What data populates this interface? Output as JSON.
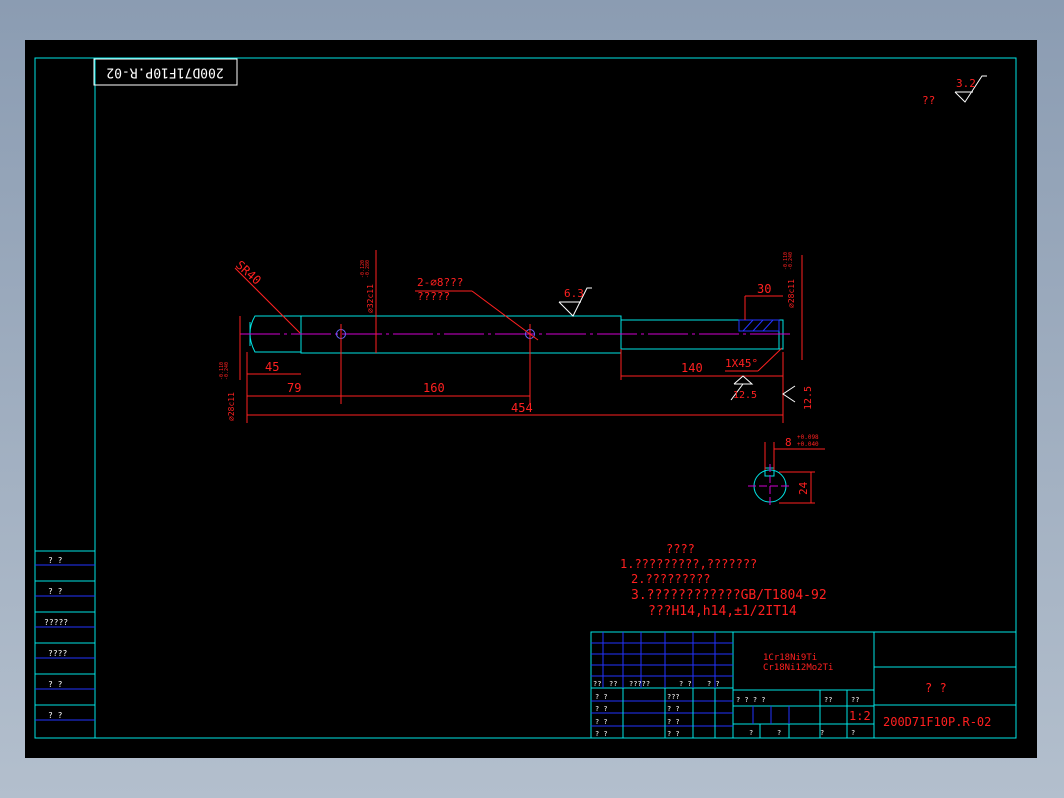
{
  "drawing_number": "200D71F10P.R-02",
  "roughness_general": {
    "symbol_text": "??",
    "value": "3.2"
  },
  "dimensions": {
    "sr": "SR40",
    "d_left": "⌀28c11",
    "d_left_tol_upper": "-0.110",
    "d_left_tol_lower": "-0.240",
    "d_mid": "⌀32c11",
    "d_mid_tol_upper": "-0.120",
    "d_mid_tol_lower": "-0.280",
    "d_right": "⌀28c11",
    "d_right_tol_upper": "-0.110",
    "d_right_tol_lower": "-0.240",
    "holes_line1": "2-⌀8???",
    "holes_line2": "?????",
    "rough_mid": "6.3",
    "len_45": "45",
    "len_79": "79",
    "len_160": "160",
    "len_454": "454",
    "len_30": "30",
    "len_140": "140",
    "chamfer": "1X45°",
    "rough_12_5_a": "12.5",
    "rough_12_5_b": "12.5",
    "key_width": "8",
    "key_tol_upper": "+0.098",
    "key_tol_lower": "+0.040",
    "key_depth": "24"
  },
  "notes": {
    "title": "????",
    "line1": "1.?????????,???????",
    "line2": "2.?????????",
    "line3": "3.????????????GB/T1804-92",
    "line4": "???H14,h14,±1/2IT14"
  },
  "left_column": [
    "?  ?",
    "?  ?",
    "?????",
    "????",
    "?  ?",
    "?  ?"
  ],
  "title_block": {
    "material1": "1Cr18Ni9Ti",
    "material2": "Cr18Ni12Mo2Ti",
    "part_name": "?    ?",
    "drawing_no": "200D71F10P.R-02",
    "scale": "1:2",
    "sign_header": [
      "??",
      "??",
      "?????",
      "?  ?",
      "?  ?"
    ],
    "sign_rows": [
      [
        "?  ?",
        "???"
      ],
      [
        "?  ?",
        "?  ?"
      ],
      [
        "?  ?",
        "?  ?"
      ],
      [
        "?  ?",
        "?  ?"
      ]
    ],
    "stage_labels": [
      "?  ?  ?  ?",
      "??",
      "??"
    ],
    "bottom_labels": [
      "?",
      "?",
      "?",
      "?"
    ]
  }
}
